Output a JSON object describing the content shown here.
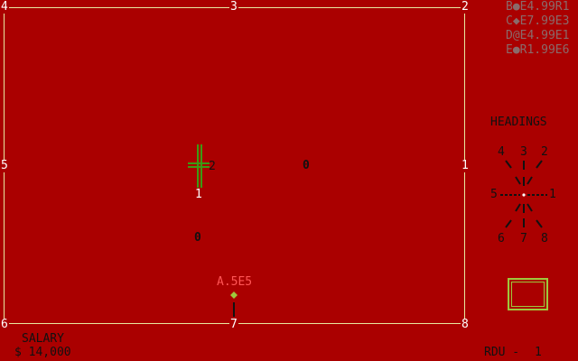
{
  "field": {
    "edge_labels": {
      "top_left": "4",
      "top_center": "3",
      "top_right": "2",
      "left_mid": "5",
      "right_mid": "1",
      "bottom_left": "6",
      "bottom_center": "7",
      "bottom_right": "8"
    },
    "aircraft": {
      "label_heading": "2",
      "label_below": "1"
    },
    "beacons": [
      {
        "label": "0"
      },
      {
        "label": "0"
      }
    ],
    "target": {
      "label": "A.5E5"
    }
  },
  "flight_list": [
    "B●E4.99R1",
    "C◆E7.99E3",
    "D@E4.99E1",
    "E●R1.99E6"
  ],
  "headings": {
    "title": "HEADINGS",
    "n4": "4",
    "n3": "3",
    "n2": "2",
    "n5": "5",
    "n1": "1",
    "n6": "6",
    "n7": "7",
    "n8": "8"
  },
  "status": {
    "salary_label": "SALARY",
    "salary_value": "$ 14,000",
    "rdu_label": "RDU -",
    "rdu_value": "1"
  },
  "colors": {
    "background": "#aa0000",
    "boundary": "#e8e8a0",
    "aircraft": "#3c9a14",
    "target_marker": "#9ec83c",
    "minimap": "#9ec83c"
  }
}
